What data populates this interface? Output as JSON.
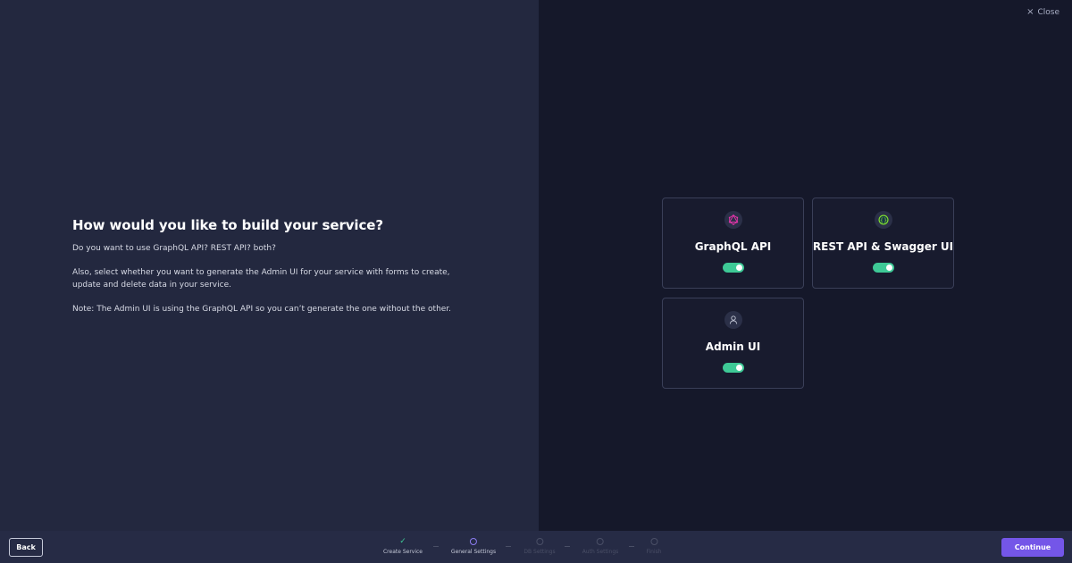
{
  "header": {
    "close_label": "Close"
  },
  "intro": {
    "title": "How would you like to build your service?",
    "paragraphs": [
      "Do you want to use GraphQL API? REST API? both?",
      "Also, select whether you want to generate the Admin UI for your service with forms to create, update and delete data in your service.",
      "Note: The Admin UI is using the GraphQL API so you can’t generate the one without the other."
    ]
  },
  "options": [
    {
      "label": "GraphQL API",
      "icon": "graphql-icon",
      "enabled": true,
      "icon_color": "#e535ab"
    },
    {
      "label": "REST API & Swagger UI",
      "icon": "swagger-icon",
      "enabled": true,
      "icon_color": "#85ea2d"
    },
    {
      "label": "Admin UI",
      "icon": "user-icon",
      "enabled": true,
      "icon_color": "#c5c9d8"
    }
  ],
  "footer": {
    "back_label": "Back",
    "continue_label": "Continue",
    "steps": [
      {
        "label": "Create Service",
        "state": "done"
      },
      {
        "label": "General Settings",
        "state": "active"
      },
      {
        "label": "DB Settings",
        "state": "pending"
      },
      {
        "label": "Auth Settings",
        "state": "pending"
      },
      {
        "label": "Finish",
        "state": "pending"
      }
    ]
  },
  "colors": {
    "accent": "#7456e8",
    "toggle_on": "#3ec996",
    "left_bg": "#23283f",
    "right_bg": "#15182a"
  }
}
